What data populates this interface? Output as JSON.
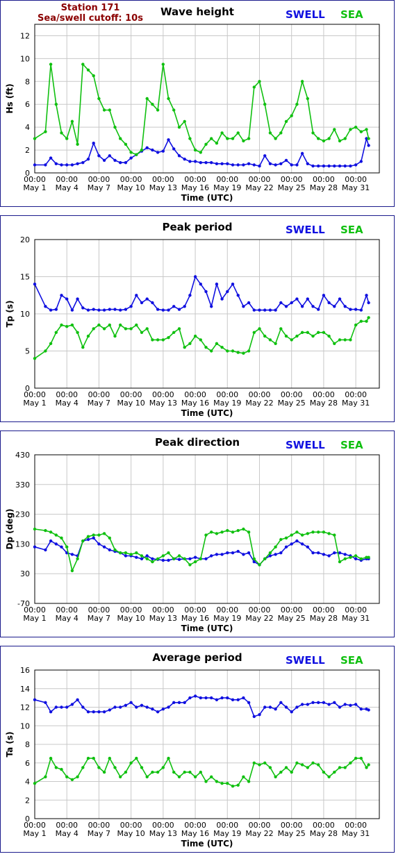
{
  "station": {
    "name": "Station 171",
    "cutoff": "Sea/swell cutoff: 10s"
  },
  "legend": {
    "swell": "SWELL",
    "sea": "SEA"
  },
  "colors": {
    "swell": "#1010e0",
    "sea": "#10c010",
    "grid": "#c8c8c8",
    "border": "#1a1a8c",
    "station": "#8b0000"
  },
  "x_ticks": [
    {
      "top": "00:00",
      "bottom": "May 1"
    },
    {
      "top": "00:00",
      "bottom": "May 4"
    },
    {
      "top": "00:00",
      "bottom": "May 7"
    },
    {
      "top": "00:00",
      "bottom": "May 10"
    },
    {
      "top": "00:00",
      "bottom": "May 13"
    },
    {
      "top": "00:00",
      "bottom": "May 16"
    },
    {
      "top": "00:00",
      "bottom": "May 19"
    },
    {
      "top": "00:00",
      "bottom": "May 22"
    },
    {
      "top": "00:00",
      "bottom": "May 25"
    },
    {
      "top": "00:00",
      "bottom": "May 28"
    },
    {
      "top": "00:00",
      "bottom": "May 31"
    }
  ],
  "chart_data": [
    {
      "type": "line",
      "title": "Wave height",
      "ylabel": "Hs (ft)",
      "xlabel": "Time (UTC)",
      "ylim": [
        0,
        13
      ],
      "yticks": [
        "0",
        "2",
        "4",
        "6",
        "8",
        "10",
        "12"
      ],
      "grid": true,
      "legend": "top-right",
      "x_days": [
        1,
        2,
        2.5,
        3,
        3.5,
        4,
        4.5,
        5,
        5.5,
        6,
        6.5,
        7,
        7.5,
        8,
        8.5,
        9,
        9.5,
        10,
        10.5,
        11,
        11.5,
        12,
        12.5,
        13,
        13.5,
        14,
        14.5,
        15,
        15.5,
        16,
        16.5,
        17,
        17.5,
        18,
        18.5,
        19,
        19.5,
        20,
        20.5,
        21,
        21.5,
        22,
        22.5,
        23,
        23.5,
        24,
        24.5,
        25,
        25.5,
        26,
        26.5,
        27,
        27.5,
        28,
        28.5,
        29,
        29.5,
        30,
        30.5,
        31,
        31.5,
        32,
        32.2
      ],
      "series": [
        {
          "name": "SWELL",
          "values": [
            0.7,
            0.7,
            1.3,
            0.8,
            0.7,
            0.7,
            0.7,
            0.8,
            0.9,
            1.2,
            2.6,
            1.5,
            1.1,
            1.5,
            1.1,
            0.9,
            0.9,
            1.3,
            1.6,
            1.9,
            2.2,
            2.0,
            1.8,
            1.9,
            2.9,
            2.1,
            1.5,
            1.2,
            1.0,
            1.0,
            0.9,
            0.9,
            0.9,
            0.8,
            0.8,
            0.8,
            0.7,
            0.7,
            0.7,
            0.8,
            0.7,
            0.6,
            1.5,
            0.8,
            0.7,
            0.8,
            1.1,
            0.7,
            0.7,
            1.7,
            0.8,
            0.6,
            0.6,
            0.6,
            0.6,
            0.6,
            0.6,
            0.6,
            0.6,
            0.7,
            1.0,
            3.0,
            2.4
          ]
        },
        {
          "name": "SEA",
          "values": [
            3.0,
            3.6,
            9.5,
            6.0,
            3.5,
            3.0,
            4.5,
            2.5,
            9.5,
            9.0,
            8.5,
            6.5,
            5.5,
            5.5,
            4.0,
            3.0,
            2.5,
            1.8,
            1.6,
            2.0,
            6.5,
            6.0,
            5.5,
            9.5,
            6.5,
            5.5,
            4.0,
            4.5,
            3.0,
            2.0,
            1.8,
            2.5,
            3.0,
            2.6,
            3.5,
            3.0,
            3.0,
            3.5,
            2.8,
            3.0,
            7.5,
            8.0,
            6.0,
            3.5,
            3.0,
            3.5,
            4.5,
            5.0,
            6.0,
            8.0,
            6.5,
            3.5,
            3.0,
            2.8,
            3.0,
            3.8,
            2.8,
            3.0,
            3.8,
            4.0,
            3.6,
            3.8,
            3.0
          ]
        }
      ]
    },
    {
      "type": "scatter",
      "title": "Peak period",
      "ylabel": "Tp (s)",
      "xlabel": "Time (UTC)",
      "ylim": [
        0,
        20
      ],
      "yticks": [
        "0",
        "5",
        "10",
        "15",
        "20"
      ],
      "grid": true,
      "legend": "top-right",
      "x_days": [
        1,
        2,
        2.5,
        3,
        3.5,
        4,
        4.5,
        5,
        5.5,
        6,
        6.5,
        7,
        7.5,
        8,
        8.5,
        9,
        9.5,
        10,
        10.5,
        11,
        11.5,
        12,
        12.5,
        13,
        13.5,
        14,
        14.5,
        15,
        15.5,
        16,
        16.5,
        17,
        17.5,
        18,
        18.5,
        19,
        19.5,
        20,
        20.5,
        21,
        21.5,
        22,
        22.5,
        23,
        23.5,
        24,
        24.5,
        25,
        25.5,
        26,
        26.5,
        27,
        27.5,
        28,
        28.5,
        29,
        29.5,
        30,
        30.5,
        31,
        31.5,
        32,
        32.2
      ],
      "series": [
        {
          "name": "SWELL",
          "values": [
            14.0,
            11.0,
            10.5,
            10.6,
            12.5,
            12.0,
            10.5,
            12.0,
            10.8,
            10.5,
            10.6,
            10.5,
            10.5,
            10.6,
            10.6,
            10.5,
            10.6,
            11.0,
            12.5,
            11.5,
            12.0,
            11.5,
            10.6,
            10.5,
            10.5,
            11.0,
            10.6,
            11.0,
            12.5,
            15.0,
            14.0,
            13.0,
            11.0,
            14.0,
            12.0,
            13.0,
            14.0,
            12.5,
            11.0,
            11.5,
            10.5,
            10.5,
            10.5,
            10.5,
            10.5,
            11.5,
            11.0,
            11.5,
            12.0,
            11.0,
            12.0,
            11.0,
            10.6,
            12.5,
            11.5,
            11.0,
            12.0,
            11.0,
            10.6,
            10.6,
            10.5,
            12.5,
            11.5
          ]
        },
        {
          "name": "SEA",
          "values": [
            4.0,
            5.0,
            6.0,
            7.5,
            8.5,
            8.3,
            8.5,
            7.5,
            5.5,
            7.0,
            8.0,
            8.5,
            8.0,
            8.5,
            7.0,
            8.5,
            8.0,
            8.0,
            8.5,
            7.5,
            8.0,
            6.5,
            6.5,
            6.5,
            6.8,
            7.5,
            8.0,
            5.5,
            6.0,
            7.0,
            6.5,
            5.5,
            5.0,
            6.0,
            5.5,
            5.0,
            5.0,
            4.8,
            4.7,
            5.0,
            7.5,
            8.0,
            7.0,
            6.5,
            6.0,
            8.0,
            7.0,
            6.5,
            7.0,
            7.5,
            7.5,
            7.0,
            7.5,
            7.5,
            7.0,
            6.0,
            6.5,
            6.5,
            6.5,
            8.5,
            9.0,
            9.0,
            9.5
          ]
        }
      ]
    },
    {
      "type": "scatter",
      "title": "Peak direction",
      "ylabel": "Dp (deg)",
      "xlabel": "Time (UTC)",
      "ylim": [
        -70,
        430
      ],
      "yticks": [
        "-70",
        "30",
        "130",
        "230",
        "330",
        "430"
      ],
      "grid": true,
      "legend": "top-right",
      "x_days": [
        1,
        2,
        2.5,
        3,
        3.5,
        4,
        4.5,
        5,
        5.5,
        6,
        6.5,
        7,
        7.5,
        8,
        8.5,
        9,
        9.5,
        10,
        10.5,
        11,
        11.5,
        12,
        12.5,
        13,
        13.5,
        14,
        14.5,
        15,
        15.5,
        16,
        16.5,
        17,
        17.5,
        18,
        18.5,
        19,
        19.5,
        20,
        20.5,
        21,
        21.5,
        22,
        22.5,
        23,
        23.5,
        24,
        24.5,
        25,
        25.5,
        26,
        26.5,
        27,
        27.5,
        28,
        28.5,
        29,
        29.5,
        30,
        30.5,
        31,
        31.5,
        32,
        32.2
      ],
      "series": [
        {
          "name": "SWELL",
          "values": [
            120,
            110,
            140,
            130,
            120,
            100,
            95,
            90,
            140,
            145,
            150,
            130,
            120,
            110,
            105,
            100,
            90,
            90,
            85,
            80,
            90,
            80,
            78,
            75,
            75,
            80,
            78,
            80,
            80,
            85,
            80,
            80,
            90,
            95,
            95,
            100,
            100,
            105,
            95,
            100,
            70,
            60,
            80,
            90,
            95,
            100,
            120,
            130,
            140,
            130,
            120,
            100,
            100,
            95,
            90,
            100,
            100,
            95,
            90,
            80,
            75,
            80,
            80
          ]
        },
        {
          "name": "SEA",
          "values": [
            180,
            175,
            170,
            160,
            150,
            120,
            40,
            80,
            140,
            155,
            160,
            160,
            165,
            150,
            110,
            100,
            100,
            95,
            100,
            90,
            80,
            70,
            80,
            90,
            100,
            80,
            90,
            80,
            60,
            70,
            80,
            160,
            170,
            165,
            170,
            175,
            170,
            175,
            180,
            170,
            80,
            60,
            80,
            100,
            120,
            145,
            150,
            160,
            170,
            160,
            165,
            170,
            170,
            170,
            165,
            160,
            70,
            80,
            85,
            90,
            80,
            85,
            85
          ]
        }
      ]
    },
    {
      "type": "scatter",
      "title": "Average period",
      "ylabel": "Ta (s)",
      "xlabel": "Time (UTC)",
      "ylim": [
        0,
        16
      ],
      "yticks": [
        "0",
        "2",
        "4",
        "6",
        "8",
        "10",
        "12",
        "14",
        "16"
      ],
      "grid": true,
      "legend": "top-right",
      "x_days": [
        1,
        2,
        2.5,
        3,
        3.5,
        4,
        4.5,
        5,
        5.5,
        6,
        6.5,
        7,
        7.5,
        8,
        8.5,
        9,
        9.5,
        10,
        10.5,
        11,
        11.5,
        12,
        12.5,
        13,
        13.5,
        14,
        14.5,
        15,
        15.5,
        16,
        16.5,
        17,
        17.5,
        18,
        18.5,
        19,
        19.5,
        20,
        20.5,
        21,
        21.5,
        22,
        22.5,
        23,
        23.5,
        24,
        24.5,
        25,
        25.5,
        26,
        26.5,
        27,
        27.5,
        28,
        28.5,
        29,
        29.5,
        30,
        30.5,
        31,
        31.5,
        32,
        32.2
      ],
      "series": [
        {
          "name": "SWELL",
          "values": [
            12.8,
            12.5,
            11.5,
            12.0,
            12.0,
            12.0,
            12.3,
            12.8,
            12.0,
            11.5,
            11.5,
            11.5,
            11.5,
            11.7,
            12.0,
            12.0,
            12.2,
            12.5,
            12.0,
            12.2,
            12.0,
            11.8,
            11.5,
            11.8,
            12.0,
            12.5,
            12.5,
            12.5,
            13.0,
            13.2,
            13.0,
            13.0,
            13.0,
            12.8,
            13.0,
            13.0,
            12.8,
            12.8,
            13.0,
            12.5,
            11.0,
            11.2,
            12.0,
            12.0,
            11.8,
            12.5,
            12.0,
            11.5,
            12.0,
            12.3,
            12.3,
            12.5,
            12.5,
            12.5,
            12.3,
            12.5,
            12.0,
            12.3,
            12.2,
            12.3,
            11.8,
            11.8,
            11.7
          ]
        },
        {
          "name": "SEA",
          "values": [
            3.8,
            4.5,
            6.5,
            5.5,
            5.3,
            4.5,
            4.2,
            4.5,
            5.5,
            6.5,
            6.5,
            5.5,
            5.0,
            6.5,
            5.5,
            4.5,
            5.0,
            6.0,
            6.5,
            5.5,
            4.5,
            5.0,
            5.0,
            5.5,
            6.5,
            5.0,
            4.5,
            5.0,
            5.0,
            4.5,
            5.0,
            4.0,
            4.5,
            4.0,
            3.8,
            3.8,
            3.5,
            3.6,
            4.5,
            4.0,
            6.0,
            5.8,
            6.0,
            5.5,
            4.5,
            5.0,
            5.5,
            5.0,
            6.0,
            5.8,
            5.5,
            6.0,
            5.8,
            5.0,
            4.5,
            5.0,
            5.5,
            5.5,
            6.0,
            6.5,
            6.5,
            5.5,
            5.8
          ]
        }
      ]
    }
  ]
}
